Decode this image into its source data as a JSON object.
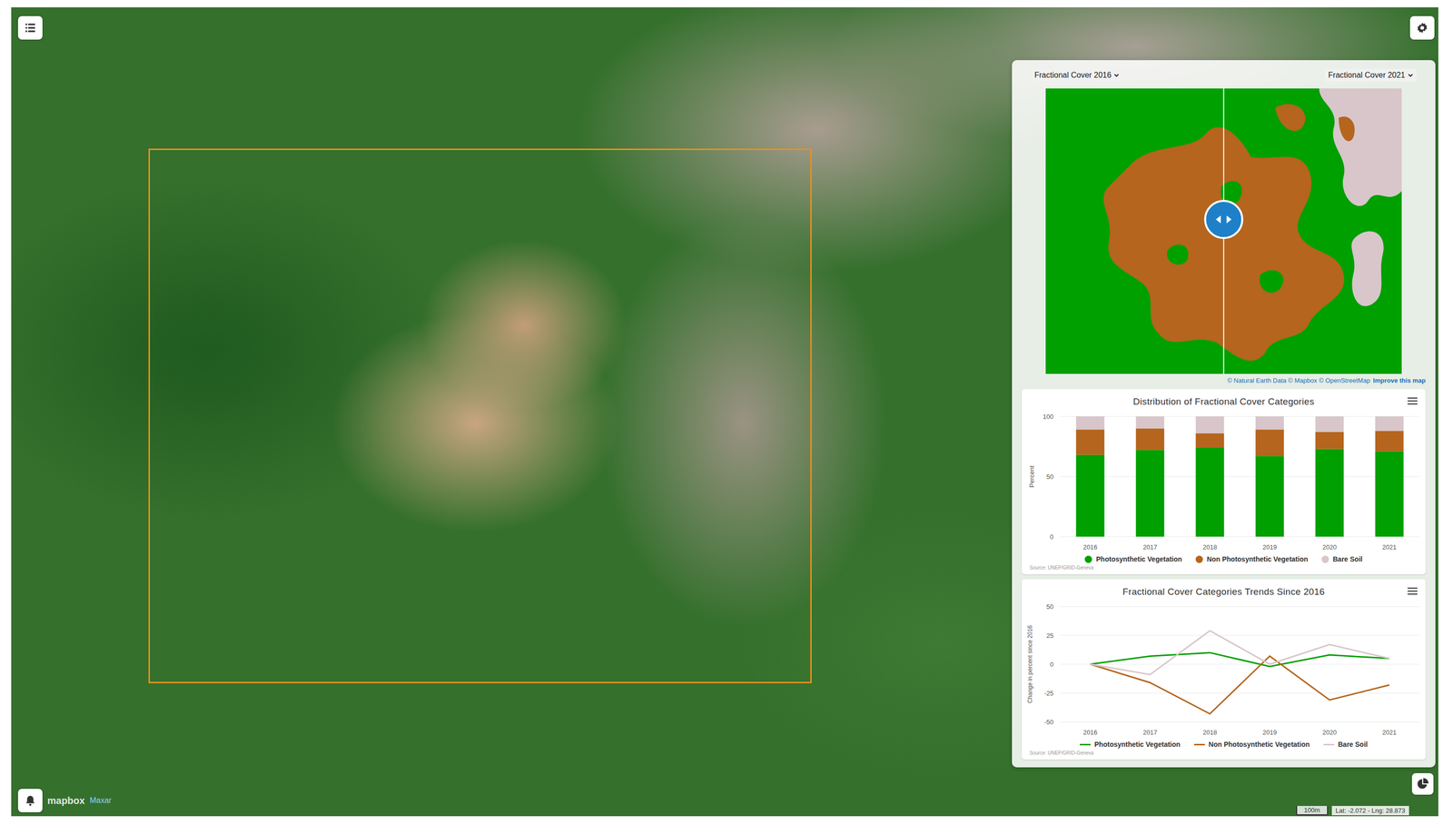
{
  "compare": {
    "left_label": "Fractional Cover 2016",
    "right_label": "Fractional Cover 2021",
    "swipe": {
      "level": 0.5
    },
    "attribution": "© Natural Earth Data © Mapbox © OpenStreetMap",
    "attribution_link": "Improve this map"
  },
  "bar_chart": {
    "title": "Distribution of Fractional Cover Categories",
    "y_label": "Percent",
    "y_ticks": [
      "100",
      "50",
      "0"
    ],
    "categories": [
      "2016",
      "2017",
      "2018",
      "2019",
      "2020",
      "2021"
    ],
    "series": [
      {
        "name": "Photosynthetic Vegetation",
        "color": "#00a000",
        "values": [
          68,
          72,
          74,
          67,
          73,
          71
        ]
      },
      {
        "name": "Non Photosynthetic Vegetation",
        "color": "#b5651d",
        "values": [
          21,
          18,
          12,
          22,
          14,
          17
        ]
      },
      {
        "name": "Bare Soil",
        "color": "#d8c6ca",
        "values": [
          11,
          10,
          14,
          11,
          13,
          12
        ]
      }
    ],
    "source": "Source: UNEP/GRID-Geneva"
  },
  "line_chart": {
    "title": "Fractional Cover Categories Trends Since 2016",
    "y_label": "Change in percent since 2016",
    "y_ticks": [
      "50",
      "25",
      "0",
      "-25",
      "-50"
    ],
    "categories": [
      "2016",
      "2017",
      "2018",
      "2019",
      "2020",
      "2021"
    ],
    "series": [
      {
        "name": "Photosynthetic Vegetation",
        "color": "#00a000",
        "values": [
          0,
          7,
          10,
          -2,
          8,
          5
        ]
      },
      {
        "name": "Non Photosynthetic Vegetation",
        "color": "#b5651d",
        "values": [
          0,
          -16,
          -43,
          7,
          -31,
          -18
        ]
      },
      {
        "name": "Bare Soil",
        "color": "#d8c6ca",
        "values": [
          0,
          -9,
          29,
          0,
          17,
          5
        ]
      }
    ],
    "source": "Source: UNEP/GRID-Geneva"
  },
  "map": {
    "logo": "mapbox",
    "imagery_credit": "Maxar",
    "scale": "100m",
    "coordinates": "Lat: -2.072 - Lng: 28.873"
  }
}
